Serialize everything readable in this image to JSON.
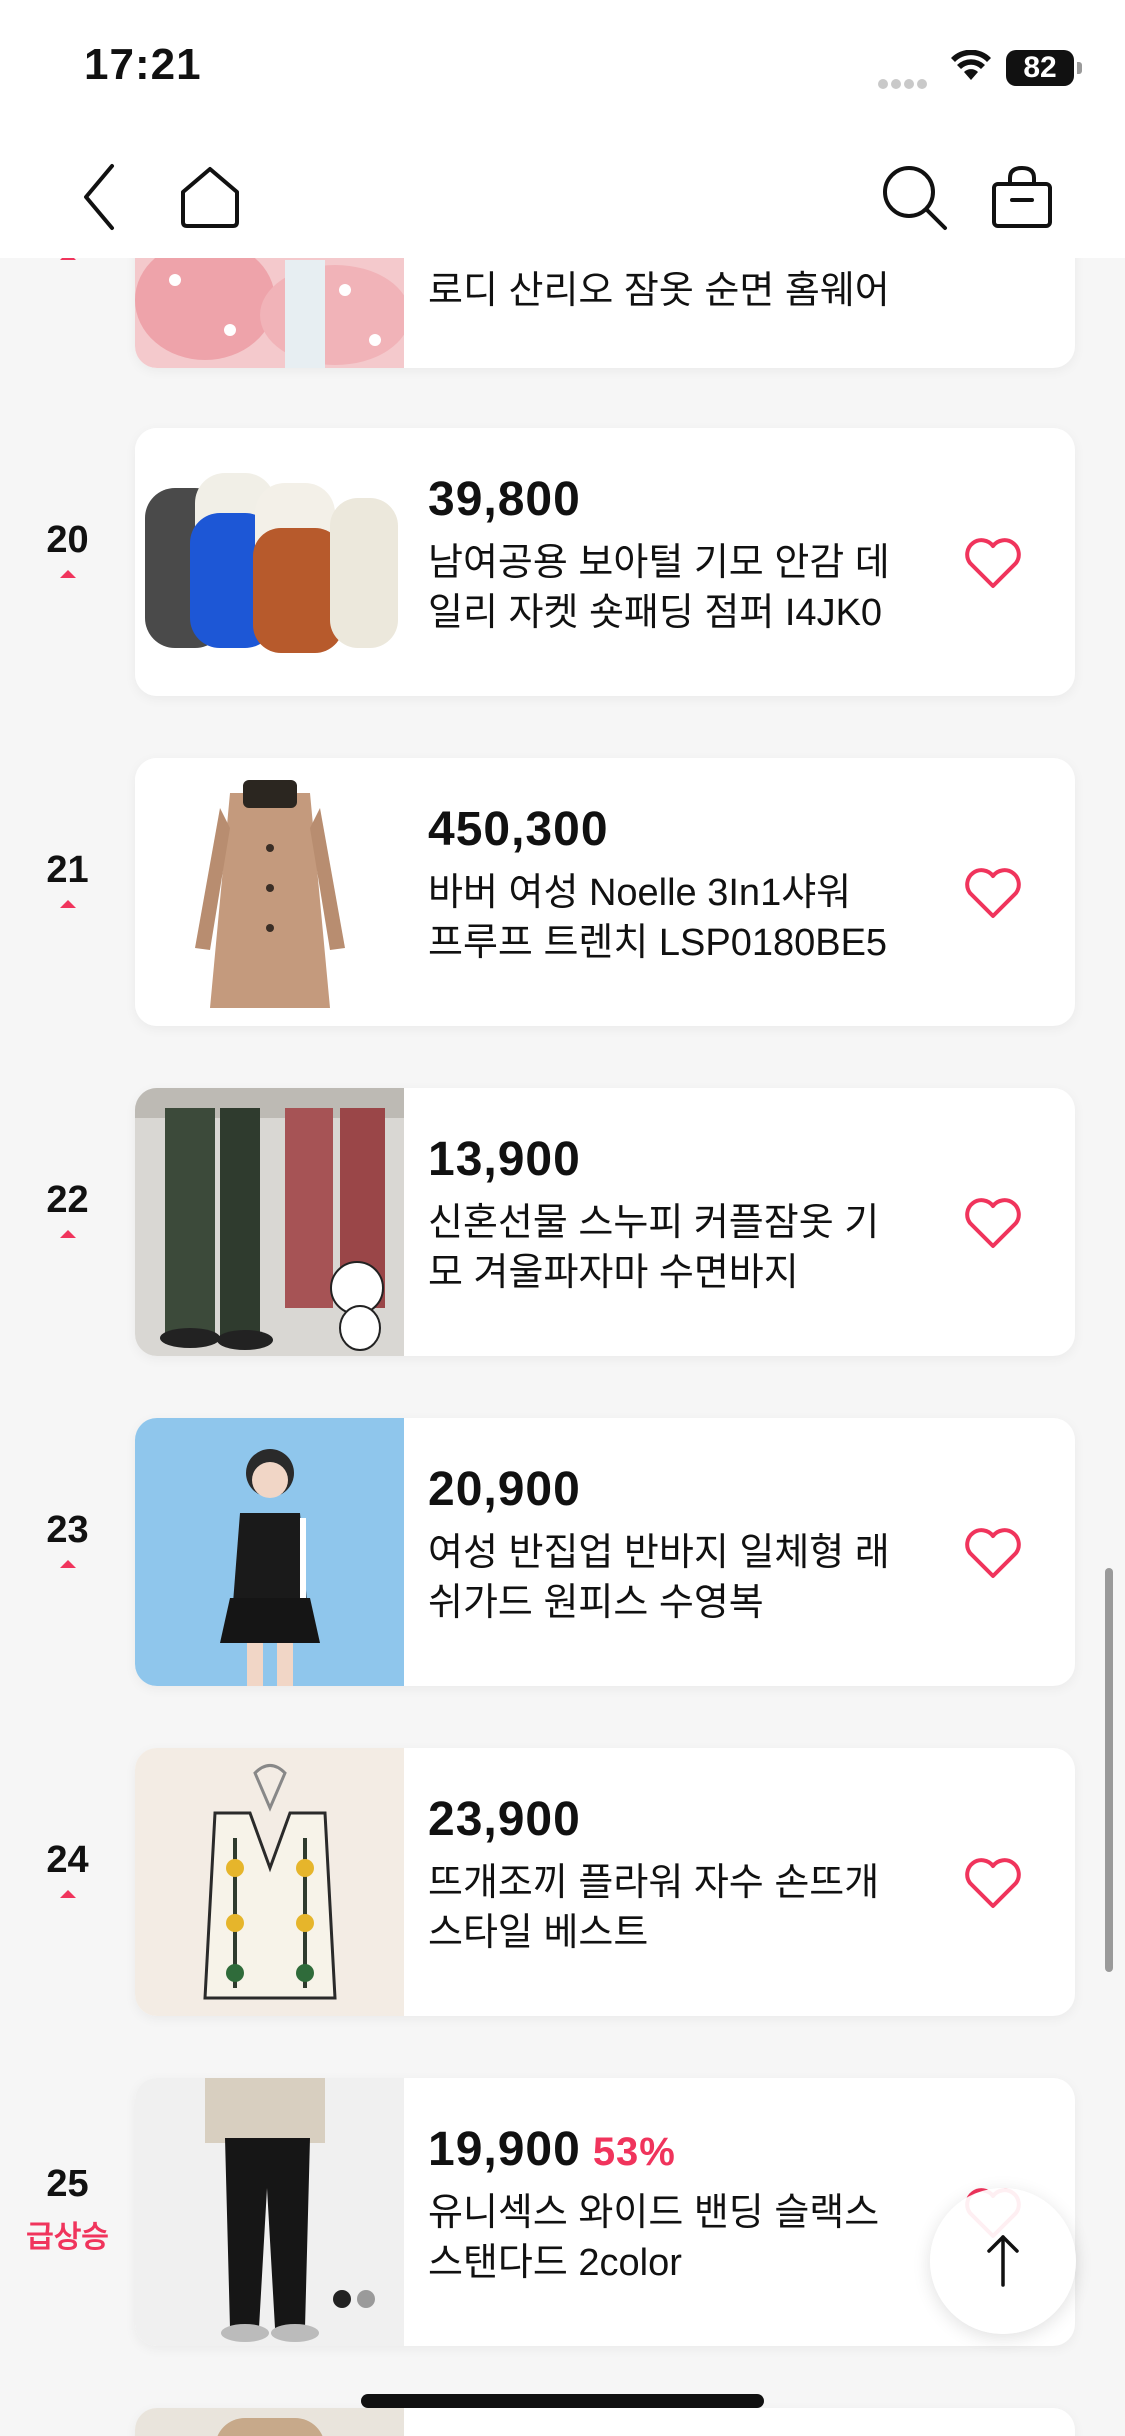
{
  "status_bar": {
    "time": "17:21",
    "battery": "82"
  },
  "nav": {
    "icons": [
      "back-icon",
      "home-icon",
      "search-icon",
      "shopping-bag-icon"
    ]
  },
  "colors": {
    "accent": "#f0345c",
    "text": "#111111",
    "background": "#f6f6f6",
    "card": "#ffffff"
  },
  "products": [
    {
      "rank": "",
      "price": "",
      "discount": "",
      "name_line1": "로디 산리오 잠옷 순면 홈웨어",
      "name_line2": "",
      "rank_label": ""
    },
    {
      "rank": "20",
      "price": "39,800",
      "discount": "",
      "name_line1": "남여공용 보아털 기모 안감 데",
      "name_line2": "일리 자켓 숏패딩 점퍼 I4JK0",
      "rank_label": ""
    },
    {
      "rank": "21",
      "price": "450,300",
      "discount": "",
      "name_line1": "바버 여성 Noelle 3In1샤워",
      "name_line2": "프루프 트렌치 LSP0180BE5",
      "rank_label": ""
    },
    {
      "rank": "22",
      "price": "13,900",
      "discount": "",
      "name_line1": "신혼선물 스누피 커플잠옷 기",
      "name_line2": "모 겨울파자마 수면바지",
      "rank_label": ""
    },
    {
      "rank": "23",
      "price": "20,900",
      "discount": "",
      "name_line1": "여성 반집업 반바지 일체형 래",
      "name_line2": "쉬가드 원피스 수영복",
      "rank_label": ""
    },
    {
      "rank": "24",
      "price": "23,900",
      "discount": "",
      "name_line1": "뜨개조끼 플라워 자수 손뜨개",
      "name_line2": "스타일 베스트",
      "rank_label": ""
    },
    {
      "rank": "25",
      "price": "19,900",
      "discount": "53%",
      "name_line1": "유니섹스 와이드 밴딩 슬랙스",
      "name_line2": "스탠다드 2color",
      "rank_label": "급상승"
    }
  ]
}
